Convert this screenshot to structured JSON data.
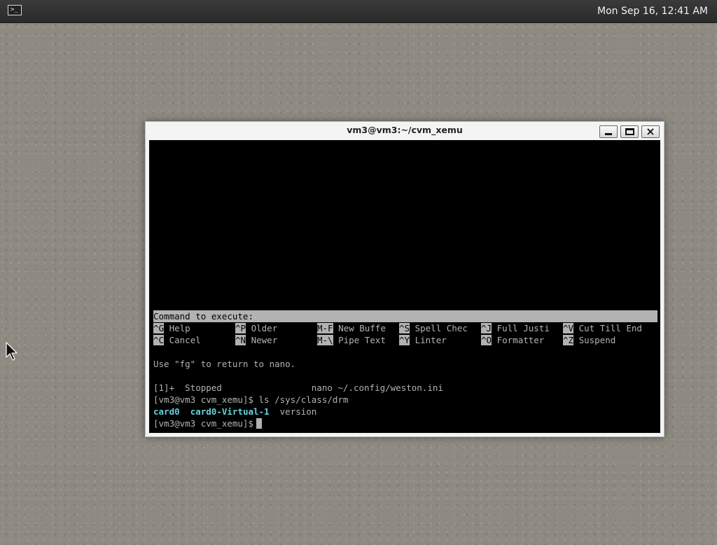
{
  "topbar": {
    "launcher_icon": "terminal-icon",
    "launcher_glyph": ">_",
    "clock": "Mon Sep 16, 12:41 AM"
  },
  "window": {
    "title": "vm3@vm3:~/cvm_xemu",
    "buttons": {
      "minimize": "minimize-icon",
      "maximize": "maximize-icon",
      "close": "close-icon",
      "close_glyph": "×"
    }
  },
  "terminal": {
    "command_prompt": "Command to execute:",
    "shortcuts_row1": [
      {
        "key": "^G",
        "label": "Help"
      },
      {
        "key": "^P",
        "label": "Older"
      },
      {
        "key": "M-F",
        "label": "New Buffe"
      },
      {
        "key": "^S",
        "label": "Spell Chec"
      },
      {
        "key": "^J",
        "label": "Full Justi"
      },
      {
        "key": "^V",
        "label": "Cut Till End"
      }
    ],
    "shortcuts_row2": [
      {
        "key": "^C",
        "label": "Cancel"
      },
      {
        "key": "^N",
        "label": "Newer"
      },
      {
        "key": "M-\\",
        "label": "Pipe Text"
      },
      {
        "key": "^Y",
        "label": "Linter"
      },
      {
        "key": "^O",
        "label": "Formatter"
      },
      {
        "key": "^Z",
        "label": "Suspend"
      }
    ],
    "fg_message": "Use \"fg\" to return to nano.",
    "job_line": "[1]+  Stopped                 nano ~/.config/weston.ini",
    "ls_command": "[vm3@vm3 cvm_xemu]$ ls /sys/class/drm",
    "ls_output": [
      "card0",
      "card0-Virtual-1",
      "version"
    ],
    "prompt": "[vm3@vm3 cvm_xemu]$"
  }
}
